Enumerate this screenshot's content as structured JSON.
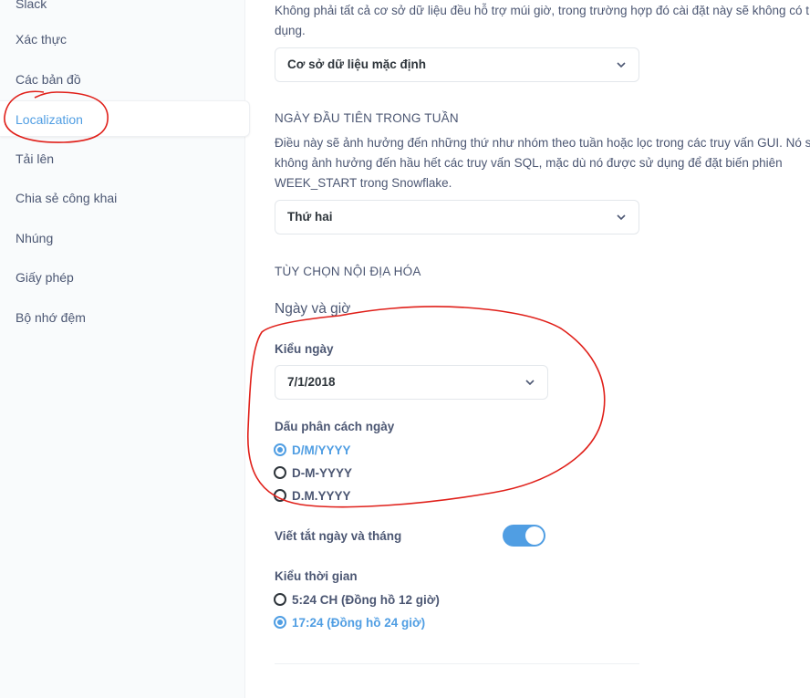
{
  "sidebar": {
    "items": [
      {
        "label": "Slack"
      },
      {
        "label": "Xác thực"
      },
      {
        "label": "Các bản đồ"
      },
      {
        "label": "Localization"
      },
      {
        "label": "Tải lên"
      },
      {
        "label": "Chia sẻ công khai"
      },
      {
        "label": "Nhúng"
      },
      {
        "label": "Giấy phép"
      },
      {
        "label": "Bộ nhớ đệm"
      }
    ],
    "active": "Localization"
  },
  "timezone": {
    "description_line1": "Không phải tất cả cơ sở dữ liệu đều hỗ trợ múi giờ, trong trường hợp đó cài đặt này sẽ không có t",
    "description_line2": "dụng.",
    "select_value": "Cơ sở dữ liệu mặc định"
  },
  "first_day": {
    "title": "NGÀY ĐẦU TIÊN TRONG TUẦN",
    "description_line1": "Điều này sẽ ảnh hưởng đến những thứ như nhóm theo tuần hoặc lọc trong các truy vấn GUI. Nó s",
    "description_line2": "không ảnh hưởng đến hầu hết các truy vấn SQL, mặc dù nó được sử dụng để đặt biến phiên",
    "description_line3": "WEEK_START trong Snowflake.",
    "select_value": "Thứ hai"
  },
  "localization": {
    "title": "TÙY CHỌN NỘI ĐỊA HÓA",
    "subtitle": "Ngày và giờ",
    "date_style_label": "Kiểu ngày",
    "date_style_value": "7/1/2018",
    "date_separator_label": "Dấu phân cách ngày",
    "date_separators": [
      {
        "label": "D/M/YYYY",
        "checked": true
      },
      {
        "label": "D-M-YYYY",
        "checked": false
      },
      {
        "label": "D.M.YYYY",
        "checked": false
      }
    ],
    "abbreviate_label": "Viết tắt ngày và tháng",
    "abbreviate_on": true,
    "time_style_label": "Kiểu thời gian",
    "time_styles": [
      {
        "label": "5:24 CH (Đồng hồ 12 giờ)",
        "checked": false
      },
      {
        "label": "17:24 (Đồng hồ 24 giờ)",
        "checked": true
      }
    ]
  },
  "colors": {
    "accent": "#509ee3",
    "annotation": "#e0201a"
  }
}
